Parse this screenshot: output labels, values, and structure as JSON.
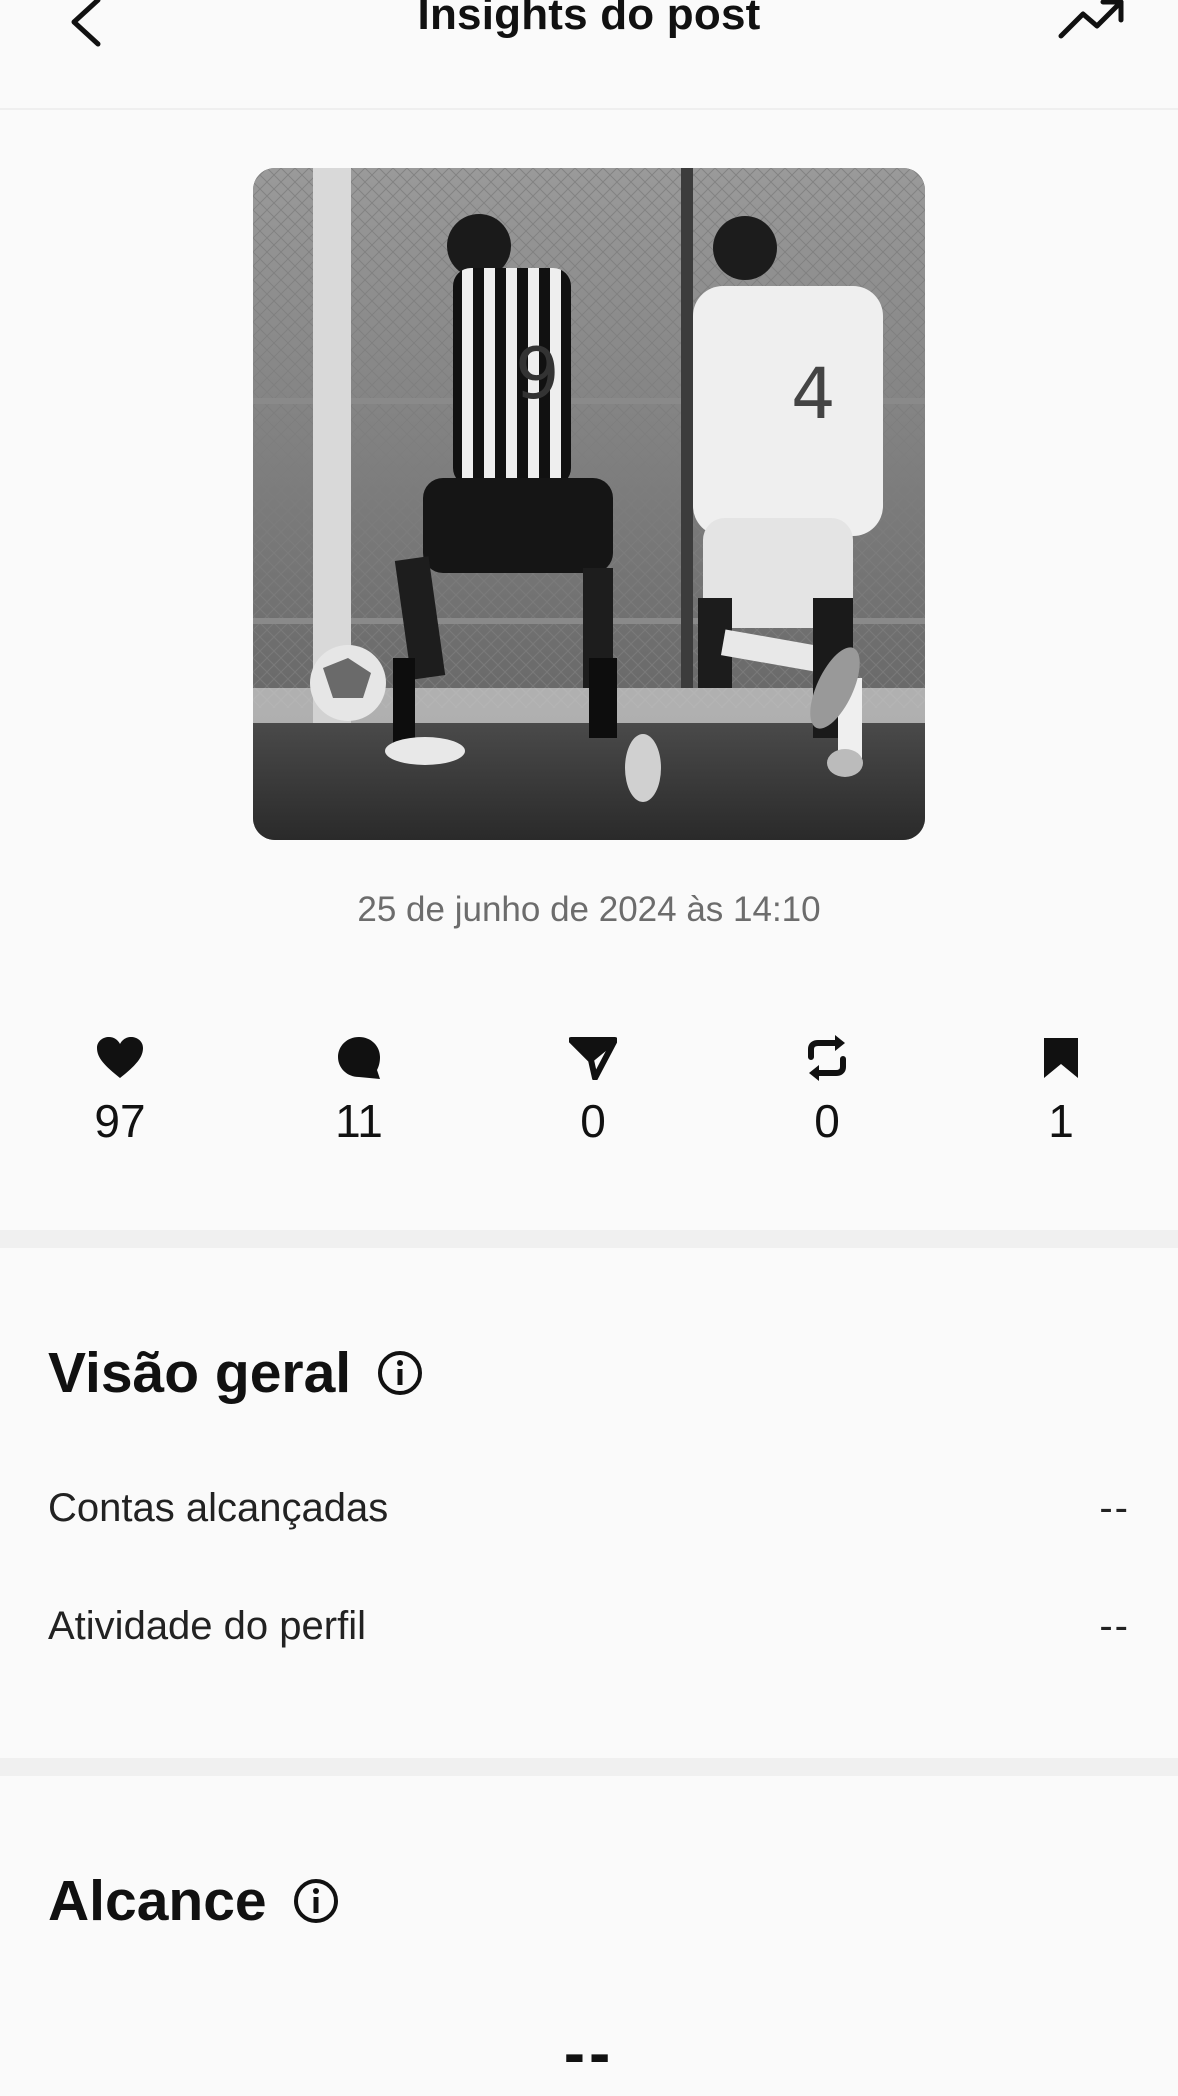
{
  "header": {
    "title": "Insights do post",
    "back_icon": "chevron-left-icon",
    "trend_icon": "trending-up-icon"
  },
  "post": {
    "image_description": "black-and-white photo of two youth football players chasing a ball",
    "date": "25 de junho de 2024 às 14:10"
  },
  "metrics": [
    {
      "icon": "heart-icon",
      "value": "97"
    },
    {
      "icon": "comment-icon",
      "value": "11"
    },
    {
      "icon": "share-icon",
      "value": "0"
    },
    {
      "icon": "repost-icon",
      "value": "0"
    },
    {
      "icon": "bookmark-icon",
      "value": "1"
    }
  ],
  "overview": {
    "title": "Visão geral",
    "rows": [
      {
        "label": "Contas alcançadas",
        "value": "--"
      },
      {
        "label": "Atividade do perfil",
        "value": "--"
      }
    ]
  },
  "reach": {
    "title": "Alcance",
    "value": "--"
  },
  "colors": {
    "background": "#fafafa",
    "text": "#111111",
    "muted": "#6c6c6c",
    "divider": "#f0f0f0"
  }
}
